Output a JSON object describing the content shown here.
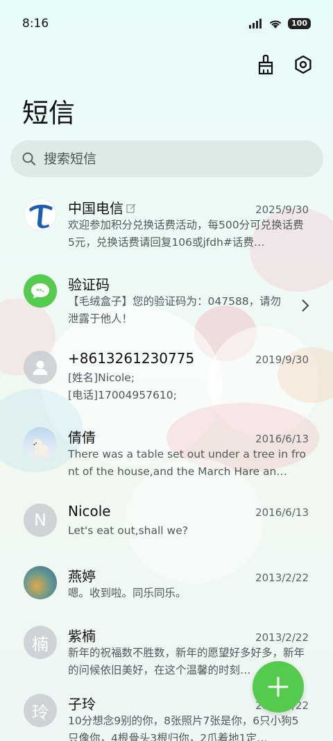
{
  "status": {
    "time": "8:16",
    "battery": "100"
  },
  "header": {
    "title": "短信"
  },
  "search": {
    "placeholder": "搜索短信"
  },
  "conversations": [
    {
      "name": "中国电信",
      "date": "2025/9/30",
      "preview": "欢迎参加积分兑换话费活动，每500分可兑换话费5元，兑换话费请回复106或jfdh#话费…",
      "avatar": "telecom-logo"
    },
    {
      "name": "验证码",
      "date": "",
      "preview": "【毛绒盒子】您的验证码为：047588，请勿泄露于他人！",
      "avatar": "message-bubble-icon"
    },
    {
      "name": "+8613261230775",
      "date": "2019/9/30",
      "preview": "[姓名]Nicole;\n[电话]17004957610;",
      "avatar": "person-icon"
    },
    {
      "name": "倩倩",
      "date": "2016/6/13",
      "preview": "There was a table set out under a tree in front of the house,and the March Hare an…",
      "avatar": "polar-bear-photo"
    },
    {
      "name": "Nicole",
      "date": "2016/6/13",
      "preview": "Let's eat out,shall we?",
      "avatar": "N"
    },
    {
      "name": "燕婷",
      "date": "2013/2/22",
      "preview": "嗯。收到啦。同乐同乐。",
      "avatar": "landscape-photo"
    },
    {
      "name": "紫楠",
      "date": "2013/2/22",
      "preview": "新年的祝福数不胜数，新年的愿望好多好多，新年的问候依旧美好，在这个温馨的时刻…",
      "avatar": "楠"
    },
    {
      "name": "子玲",
      "date": "2013/2/22",
      "preview": "10分想念9别的你，8张照片7张是你，6只小狗5只像你，4根骨头3根归你，2爪着地1定…",
      "avatar": "玲"
    }
  ],
  "colors": {
    "accent": "#55cb4e",
    "telecom": "#1a5fb4"
  }
}
